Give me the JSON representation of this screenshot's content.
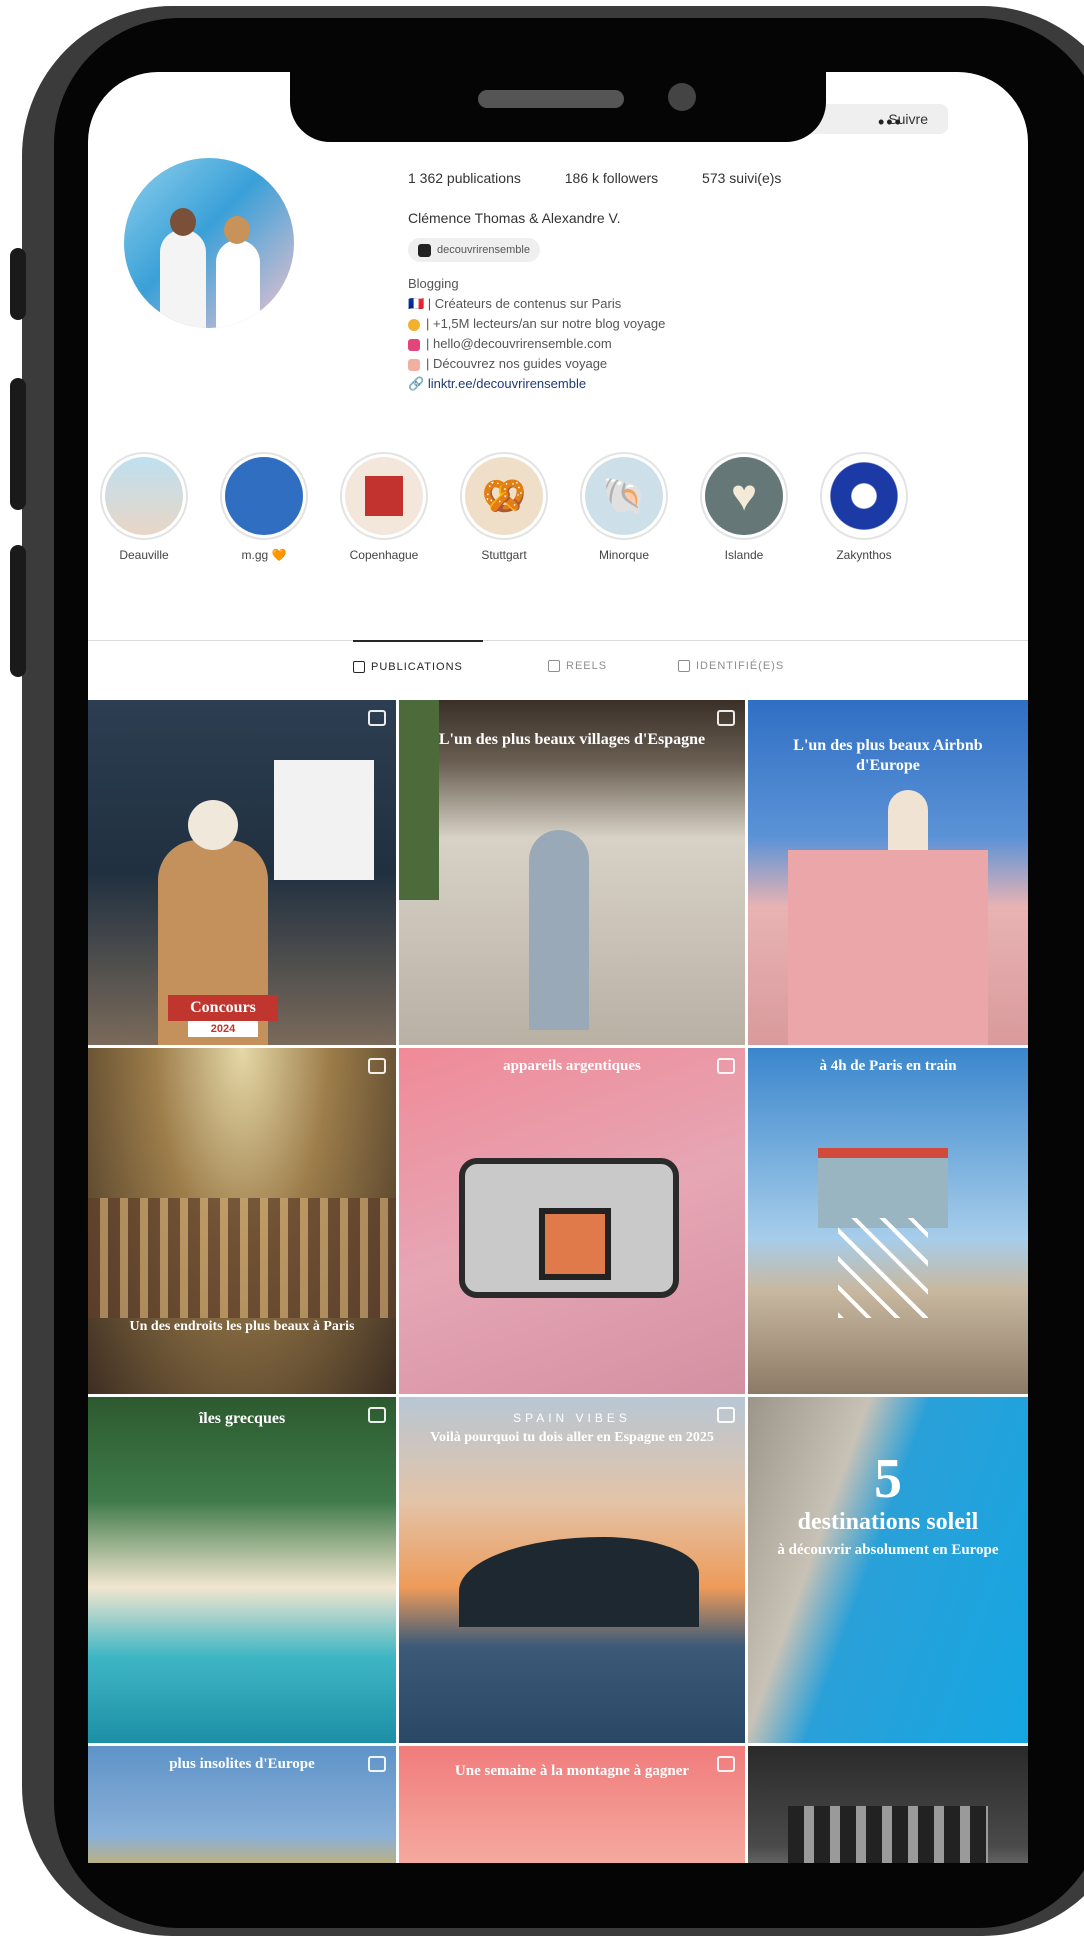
{
  "header": {
    "follow_label": "Suivre",
    "more_label": "•••"
  },
  "profile": {
    "stats": {
      "publications": "1 362 publications",
      "followers": "186 k followers",
      "following": "573 suivi(e)s"
    },
    "name": "Clémence Thomas & Alexandre V.",
    "threads_handle": "decouvrirensemble",
    "bio": {
      "category": "Blogging",
      "line1": "🇫🇷 | Créateurs de contenus sur Paris",
      "line2": "| +1,5M lecteurs/an sur notre blog voyage",
      "line3": "| hello@decouvrirensemble.com",
      "line4": "| Découvrez nos guides voyage",
      "link": "linktr.ee/decouvrirensemble"
    }
  },
  "highlights": [
    {
      "label": "Deauville",
      "color": "#cfe3ee",
      "glyph": ""
    },
    {
      "label": "m.gg 🧡",
      "color": "#2f6ec0",
      "glyph": ""
    },
    {
      "label": "Copenhague",
      "color": "#f3e7dc",
      "glyph": "🏛"
    },
    {
      "label": "Stuttgart",
      "color": "#f0dfc8",
      "glyph": "🥨"
    },
    {
      "label": "Minorque",
      "color": "#cde0ea",
      "glyph": "🐚"
    },
    {
      "label": "Islande",
      "color": "#667778",
      "glyph": "♥"
    },
    {
      "label": "Zakynthos",
      "color": "#1c3aa6",
      "glyph": ""
    }
  ],
  "tabs": {
    "posts": "PUBLICATIONS",
    "reels": "REELS",
    "tagged": "IDENTIFIÉ(E)S"
  },
  "posts": [
    {
      "caption": "",
      "badge": "Concours",
      "badge_sub": "2024"
    },
    {
      "caption": "L'un des plus beaux villages d'Espagne"
    },
    {
      "caption": "L'un des plus beaux Airbnb d'Europe"
    },
    {
      "caption": "Un des endroits les plus beaux à Paris"
    },
    {
      "caption": "appareils argentiques"
    },
    {
      "caption": "à 4h de Paris en train"
    },
    {
      "caption": "îles grecques"
    },
    {
      "kicker": "SPAIN VIBES",
      "caption": "Voilà pourquoi tu dois aller en Espagne en 2025"
    },
    {
      "big": "5",
      "caption": "destinations soleil",
      "sub": "à découvrir absolument en Europe"
    },
    {
      "caption": "plus insolites d'Europe"
    },
    {
      "caption": "Une semaine à la montagne à gagner"
    },
    {
      "caption": ""
    }
  ]
}
